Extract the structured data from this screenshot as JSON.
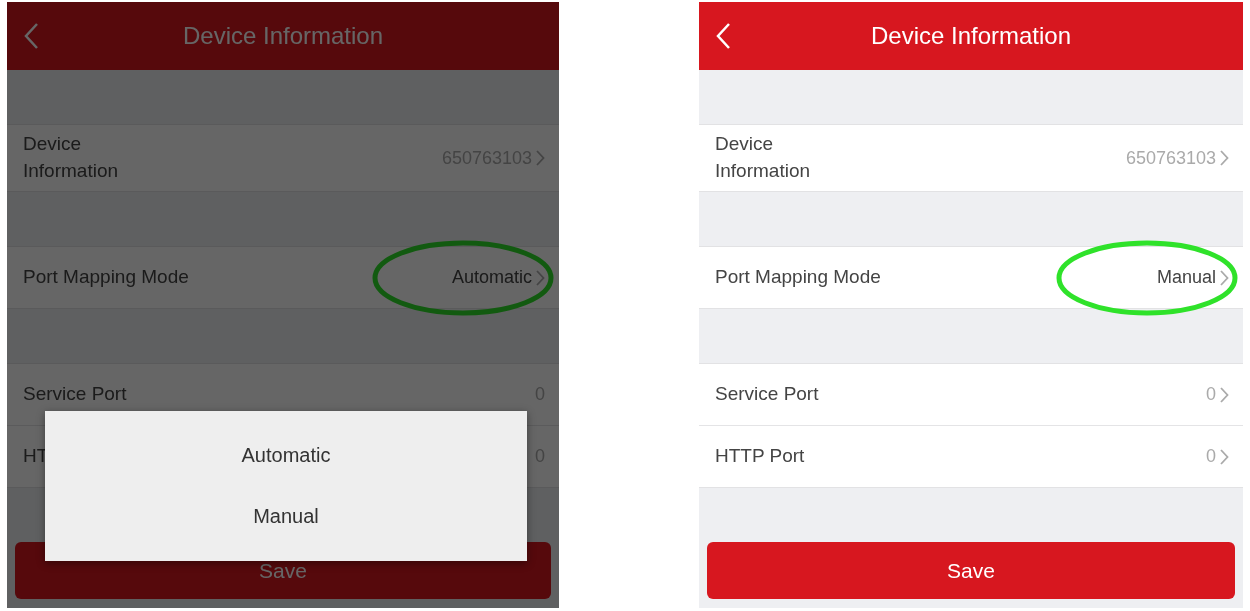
{
  "screens": [
    {
      "title": "Device Information",
      "dimmed": true,
      "sections": [
        [
          {
            "label": "Device Information",
            "wrap": true,
            "value": "650763103",
            "chevron": true,
            "highlighted": false
          }
        ],
        [
          {
            "label": "Port Mapping Mode",
            "wrap": false,
            "value": "Automatic",
            "chevron": true,
            "highlighted": true
          }
        ],
        [
          {
            "label": "Service Port",
            "wrap": false,
            "value": "0",
            "chevron": false,
            "highlighted": false
          },
          {
            "label": "HT",
            "wrap": false,
            "value": "0",
            "chevron": false,
            "highlighted": false
          }
        ]
      ],
      "save": "Save",
      "popup": {
        "options": [
          "Automatic",
          "Manual"
        ]
      }
    },
    {
      "title": "Device Information",
      "dimmed": false,
      "sections": [
        [
          {
            "label": "Device Information",
            "wrap": true,
            "value": "650763103",
            "chevron": true,
            "highlighted": false
          }
        ],
        [
          {
            "label": "Port Mapping Mode",
            "wrap": false,
            "value": "Manual",
            "chevron": true,
            "highlighted": true
          }
        ],
        [
          {
            "label": "Service Port",
            "wrap": false,
            "value": "0",
            "chevron": true,
            "highlighted": false
          },
          {
            "label": "HTTP Port",
            "wrap": false,
            "value": "0",
            "chevron": true,
            "highlighted": false
          }
        ]
      ],
      "save": "Save"
    }
  ]
}
